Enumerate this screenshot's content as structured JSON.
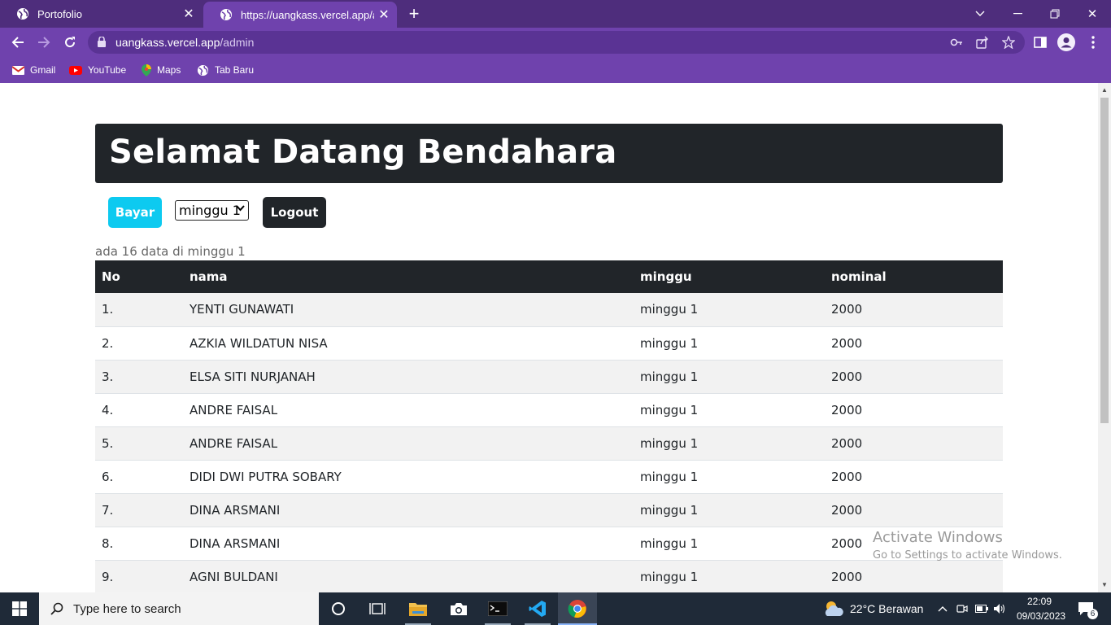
{
  "browser": {
    "tabs": [
      {
        "title": "Portofolio",
        "active": false
      },
      {
        "title": "https://uangkass.vercel.app/admin",
        "active": true
      }
    ],
    "url_host": "uangkass.vercel.app",
    "url_path": "/admin",
    "bookmarks": [
      "Gmail",
      "YouTube",
      "Maps",
      "Tab Baru"
    ]
  },
  "page": {
    "title": "Selamat Datang Bendahara",
    "bayar_label": "Bayar",
    "week_select": "minggu 1",
    "logout_label": "Logout",
    "count_text": "ada 16 data di minggu 1",
    "headers": [
      "No",
      "nama",
      "minggu",
      "nominal"
    ],
    "rows": [
      {
        "no": "1.",
        "nama": "YENTI GUNAWATI",
        "minggu": "minggu 1",
        "nominal": "2000"
      },
      {
        "no": "2.",
        "nama": "AZKIA WILDATUN NISA",
        "minggu": "minggu 1",
        "nominal": "2000"
      },
      {
        "no": "3.",
        "nama": "ELSA SITI NURJANAH",
        "minggu": "minggu 1",
        "nominal": "2000"
      },
      {
        "no": "4.",
        "nama": "ANDRE FAISAL",
        "minggu": "minggu 1",
        "nominal": "2000"
      },
      {
        "no": "5.",
        "nama": "ANDRE FAISAL",
        "minggu": "minggu 1",
        "nominal": "2000"
      },
      {
        "no": "6.",
        "nama": "DIDI DWI PUTRA SOBARY",
        "minggu": "minggu 1",
        "nominal": "2000"
      },
      {
        "no": "7.",
        "nama": "DINA ARSMANI",
        "minggu": "minggu 1",
        "nominal": "2000"
      },
      {
        "no": "8.",
        "nama": "DINA ARSMANI",
        "minggu": "minggu 1",
        "nominal": "2000"
      },
      {
        "no": "9.",
        "nama": "AGNI BULDANI",
        "minggu": "minggu 1",
        "nominal": "2000"
      }
    ]
  },
  "watermark": {
    "line1": "Activate Windows",
    "line2": "Go to Settings to activate Windows."
  },
  "taskbar": {
    "search_placeholder": "Type here to search",
    "weather": "22°C  Berawan",
    "time": "22:09",
    "date": "09/03/2023",
    "notification_count": "6"
  },
  "colors": {
    "chrome_dark": "#4e2d7c",
    "chrome_light": "#6f42ad",
    "header_dark": "#212529",
    "info_button": "#0dcaf0"
  }
}
